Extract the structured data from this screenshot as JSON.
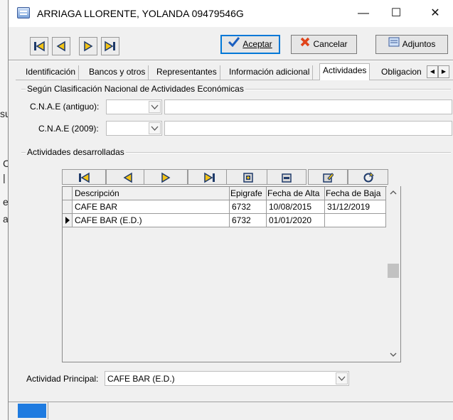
{
  "background": {
    "left_chars": [
      "su",
      "Co",
      "|",
      "e",
      "a"
    ]
  },
  "window": {
    "title": "ARRIAGA LLORENTE, YOLANDA  09479546G",
    "controls": {
      "minimize": "—",
      "maximize": "☐",
      "close": "✕"
    }
  },
  "toolbar": {
    "nav": [
      "first",
      "previous",
      "next",
      "last"
    ],
    "accept_label": "Aceptar",
    "cancel_label": "Cancelar",
    "attachments_label": "Adjuntos"
  },
  "tabs": [
    {
      "label": "Identificación",
      "active": false
    },
    {
      "label": "Bancos y otros",
      "active": false
    },
    {
      "label": "Representantes",
      "active": false
    },
    {
      "label": "Información adicional",
      "active": false
    },
    {
      "label": "Actividades",
      "active": true
    },
    {
      "label": "Obligacion",
      "active": false
    }
  ],
  "cnae": {
    "group_title": "Según Clasificación Nacional de Actividades Económicas",
    "old_label": "C.N.A.E (antiguo):",
    "old_value": "",
    "old_desc": "",
    "new_label": "C.N.A.E (2009):",
    "new_value": "",
    "new_desc": ""
  },
  "activities": {
    "group_title": "Actividades desarrolladas",
    "grid_toolbar": [
      "first-record",
      "previous-record",
      "next-record",
      "last-record",
      "insert-record",
      "delete-record",
      "edit-record",
      "refresh-records"
    ],
    "columns": [
      "Descripción",
      "Epigrafe",
      "Fecha de Alta",
      "Fecha de Baja"
    ],
    "rows": [
      {
        "current": false,
        "cells": [
          "CAFE BAR",
          "6732",
          "10/08/2015",
          "31/12/2019"
        ]
      },
      {
        "current": true,
        "cells": [
          "CAFE BAR (E.D.)",
          "6732",
          "01/01/2020",
          ""
        ]
      }
    ]
  },
  "principal": {
    "label": "Actividad Principal:",
    "value": "CAFE BAR (E.D.)"
  },
  "colors": {
    "accent": "#0078d7",
    "status_blue": "#1f7be0",
    "nav_yellow": "#f3c316",
    "nav_dark": "#1e3a6a"
  }
}
